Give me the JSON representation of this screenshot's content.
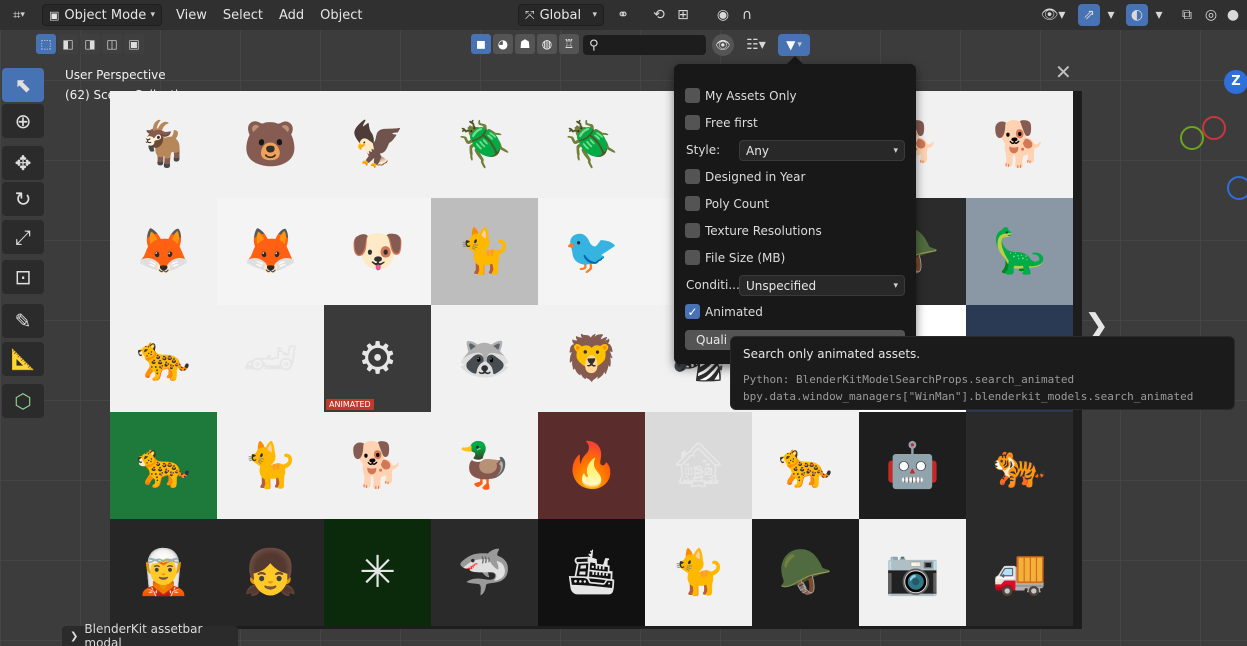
{
  "header": {
    "editor_icon": "⌗",
    "mode": "Object Mode",
    "menus": [
      "View",
      "Select",
      "Add",
      "Object"
    ],
    "transform_orientation": "Global"
  },
  "viewport": {
    "perspective": "User Perspective",
    "collection": "(62) Scene Collection"
  },
  "toolbar": {
    "tools": [
      "select-box",
      "cursor",
      "move",
      "rotate",
      "scale",
      "transform",
      "annotate",
      "measure",
      "add-cube"
    ]
  },
  "asset_bar": {
    "search_placeholder": "",
    "rows": [
      [
        {
          "icon": "🐐",
          "bg": "#f1f1f1"
        },
        {
          "icon": "🐻",
          "bg": "#f1f1f1"
        },
        {
          "icon": "🦅",
          "bg": "#f1f1f1"
        },
        {
          "icon": "🪲",
          "bg": "#f1f1f1"
        },
        {
          "icon": "🪲",
          "bg": "#f1f1f1"
        },
        {
          "icon": "",
          "bg": "#f1f1f1"
        },
        {
          "icon": "",
          "bg": "#f1f1f1"
        },
        {
          "icon": "🐕",
          "bg": "#f1f1f1"
        },
        {
          "icon": "🐕",
          "bg": "#f1f1f1"
        }
      ],
      [
        {
          "icon": "🦊",
          "bg": "#f1f1f1"
        },
        {
          "icon": "🦊",
          "bg": "#f4f4f4"
        },
        {
          "icon": "🐶",
          "bg": "#f4f4f4"
        },
        {
          "icon": "🐈",
          "bg": "#bdbdbd"
        },
        {
          "icon": "🐦",
          "bg": "#f4f4f4"
        },
        {
          "icon": "",
          "bg": "#f4f4f4"
        },
        {
          "icon": "",
          "bg": "#f4f4f4"
        },
        {
          "icon": "🪖",
          "bg": "#2b2b2b"
        },
        {
          "icon": "🦕",
          "bg": "#8a98a6"
        }
      ],
      [
        {
          "icon": "🐆",
          "bg": "#f1f1f1"
        },
        {
          "icon": "🏎",
          "bg": "#f1f1f1"
        },
        {
          "icon": "⚙",
          "bg": "#3a3a3a",
          "label": "ANIMATED"
        },
        {
          "icon": "🦝",
          "bg": "#f1f1f1"
        },
        {
          "icon": "🦁",
          "bg": "#f1f1f1"
        },
        {
          "icon": "🦓",
          "bg": "#f1f1f1"
        },
        {
          "icon": "",
          "bg": "#f1f1f1"
        },
        {
          "icon": "",
          "bg": "#ffffff"
        },
        {
          "icon": "",
          "bg": "#2a3a55"
        }
      ],
      [
        {
          "icon": "🐆",
          "bg": "#1e7a3a"
        },
        {
          "icon": "🐈",
          "bg": "#f1f1f1"
        },
        {
          "icon": "🐕",
          "bg": "#f1f1f1"
        },
        {
          "icon": "🦆",
          "bg": "#f1f1f1"
        },
        {
          "icon": "🔥",
          "bg": "#5a2c2c"
        },
        {
          "icon": "🏚",
          "bg": "#dadada"
        },
        {
          "icon": "🐆",
          "bg": "#f1f1f1"
        },
        {
          "icon": "🤖",
          "bg": "#1e1e1e"
        },
        {
          "icon": "🐅",
          "bg": "#2a2a2a"
        }
      ],
      [
        {
          "icon": "🧝",
          "bg": "#262626"
        },
        {
          "icon": "👧",
          "bg": "#262626"
        },
        {
          "icon": "✳",
          "bg": "#0b2a0b"
        },
        {
          "icon": "🦈",
          "bg": "#2a2a2a"
        },
        {
          "icon": "🛳",
          "bg": "#111111"
        },
        {
          "icon": "🐈",
          "bg": "#f1f1f1"
        },
        {
          "icon": "🪖",
          "bg": "#1e1e1e"
        },
        {
          "icon": "📷",
          "bg": "#f1f1f1"
        },
        {
          "icon": "🚚",
          "bg": "#2a2a2a"
        }
      ]
    ]
  },
  "filter_popup": {
    "my_assets_only": {
      "label": "My Assets Only",
      "checked": false
    },
    "free_first": {
      "label": "Free first",
      "checked": false
    },
    "style_label": "Style:",
    "style_value": "Any",
    "designed_in_year": {
      "label": "Designed in Year",
      "checked": false
    },
    "poly_count": {
      "label": "Poly Count",
      "checked": false
    },
    "texture_resolutions": {
      "label": "Texture Resolutions",
      "checked": false
    },
    "file_size": {
      "label": "File Size (MB)",
      "checked": false
    },
    "condition_label": "Conditi...",
    "condition_value": "Unspecified",
    "animated": {
      "label": "Animated",
      "checked": true
    },
    "quality_label": "Quali"
  },
  "tooltip": {
    "title": "Search only animated assets.",
    "python_line1": "Python: BlenderKitModelSearchProps.search_animated",
    "python_line2": "bpy.data.window_managers[\"WinMan\"].blenderkit_models.search_animated"
  },
  "statusbar": {
    "label": "BlenderKit assetbar modal"
  },
  "colors": {
    "accent": "#4772b3",
    "header_bg": "#303030",
    "popup_bg": "#181818"
  }
}
